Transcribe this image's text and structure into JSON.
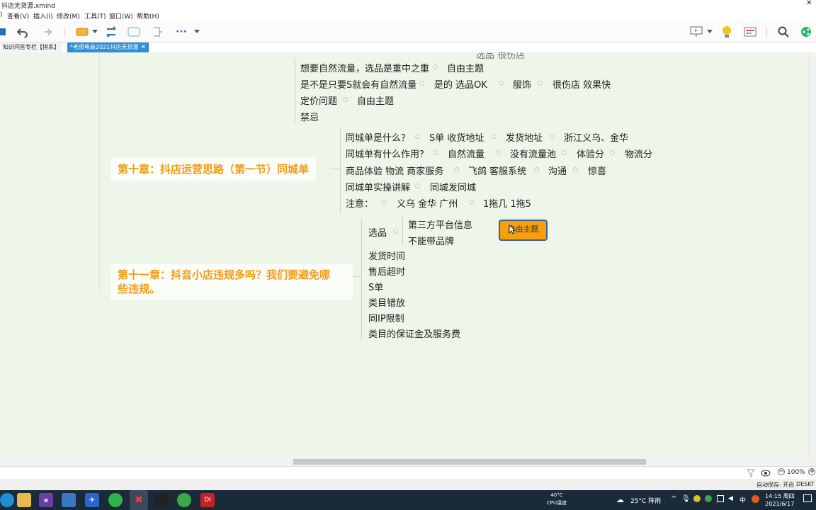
{
  "window": {
    "title": "抖店无货源.xmind"
  },
  "menu": [
    "查看(V)",
    "插入(I)",
    "修改(M)",
    "工具(T)",
    "窗口(W)",
    "帮助(H)"
  ],
  "tabs": [
    {
      "label": "知识问答专栏【拼系】"
    },
    {
      "label": "*老邵电商2021抖店无货源",
      "close": "✕"
    }
  ],
  "top_partial": "选品 很伤店",
  "upper_items": [
    {
      "label": "想要自然流量，选品是重中之重",
      "children": [
        "自由主题"
      ]
    },
    {
      "label": "是不是只要S就会有自然流量",
      "children": [
        "是的  选品OK",
        "服饰",
        "很伤店  效果快"
      ]
    },
    {
      "label": "定价问题",
      "children": [
        "自由主题"
      ]
    },
    {
      "label": "禁忌",
      "children": []
    }
  ],
  "chapter10": {
    "title": "第十章：抖店运营思路（第一节）同城单",
    "items": [
      {
        "label": "同城单是什么？",
        "children": [
          "S单  收货地址",
          "发货地址",
          "浙江义乌、金华"
        ]
      },
      {
        "label": "同城单有什么作用？",
        "children": [
          "自然流量",
          "没有流量池",
          "体验分",
          "物流分"
        ]
      },
      {
        "label": "商品体验  物流  商家服务",
        "children": [
          "飞鸽  客服系统",
          "沟通",
          "惊喜"
        ]
      },
      {
        "label": "同城单实操讲解",
        "children": [
          "同城发同城"
        ]
      },
      {
        "label": "注意：",
        "children": [
          "义乌  金华  广州",
          "1拖几  1拖5"
        ]
      }
    ]
  },
  "chapter11": {
    "title_line1": "第十一章：抖音小店违规多吗？我们要避免哪",
    "title_line2": "些违规。",
    "items": [
      {
        "label": "选品",
        "children": [
          "第三方平台信息",
          "不能带品牌"
        ]
      },
      {
        "label": "发货时间"
      },
      {
        "label": "售后超时"
      },
      {
        "label": "S单"
      },
      {
        "label": "类目错放"
      },
      {
        "label": "同IP限制"
      },
      {
        "label": "类目的保证金及服务费"
      }
    ]
  },
  "floating_topic": {
    "label": "自由主题"
  },
  "status": {
    "zoom": "100%",
    "minus": "−",
    "plus": "+"
  },
  "autosave": {
    "label": "自动保存: 开启",
    "device": "DESKT"
  },
  "taskbar": {
    "cpu_temp": "40°C",
    "cpu_label": "CPU温度",
    "weather": "25°C  阵雨",
    "ime": "中",
    "time": "14:15 周四",
    "date": "2021/6/17"
  }
}
